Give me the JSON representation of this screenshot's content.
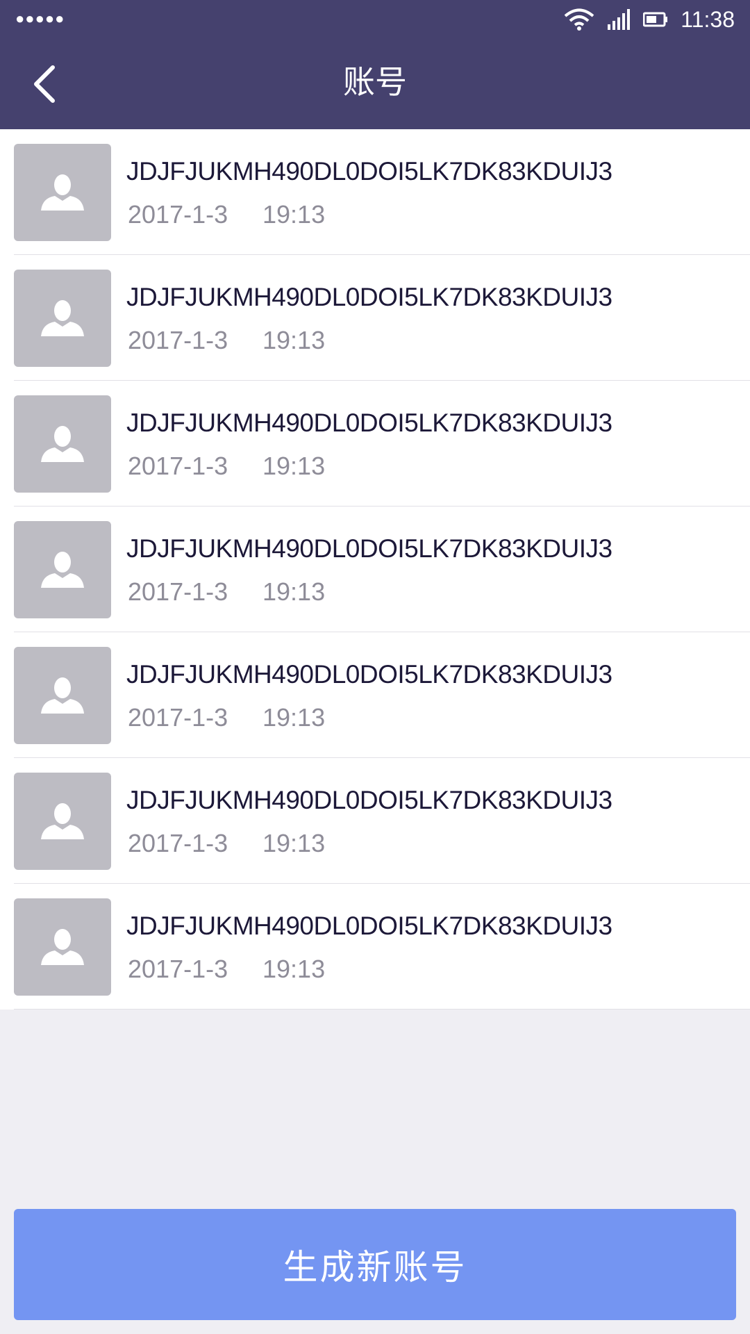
{
  "status_bar": {
    "time": "11:38",
    "signal_dots": "●●●●●",
    "icons": [
      "wifi-icon",
      "cell-signal-icon",
      "battery-icon"
    ]
  },
  "header": {
    "title": "账号",
    "back_icon": "chevron-left-icon"
  },
  "accounts": [
    {
      "id": "JDJFJUKMH490DL0DOI5LK7DK83KDUIJ3",
      "date": "2017-1-3",
      "time": "19:13"
    },
    {
      "id": "JDJFJUKMH490DL0DOI5LK7DK83KDUIJ3",
      "date": "2017-1-3",
      "time": "19:13"
    },
    {
      "id": "JDJFJUKMH490DL0DOI5LK7DK83KDUIJ3",
      "date": "2017-1-3",
      "time": "19:13"
    },
    {
      "id": "JDJFJUKMH490DL0DOI5LK7DK83KDUIJ3",
      "date": "2017-1-3",
      "time": "19:13"
    },
    {
      "id": "JDJFJUKMH490DL0DOI5LK7DK83KDUIJ3",
      "date": "2017-1-3",
      "time": "19:13"
    },
    {
      "id": "JDJFJUKMH490DL0DOI5LK7DK83KDUIJ3",
      "date": "2017-1-3",
      "time": "19:13"
    },
    {
      "id": "JDJFJUKMH490DL0DOI5LK7DK83KDUIJ3",
      "date": "2017-1-3",
      "time": "19:13"
    }
  ],
  "footer": {
    "generate_label": "生成新账号"
  },
  "colors": {
    "header_bg": "#45416e",
    "page_bg": "#efeef3",
    "button_bg": "#7495f2",
    "avatar_bg": "#bdbcc3",
    "id_text": "#1c1838",
    "meta_text": "#8e8c98"
  }
}
